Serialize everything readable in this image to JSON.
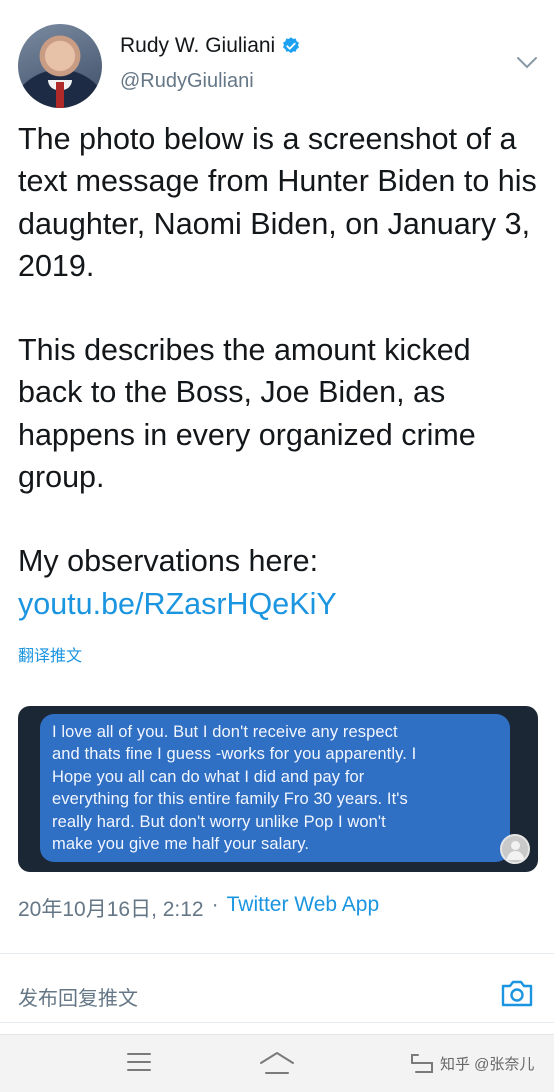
{
  "tweet": {
    "display_name": "Rudy W. Giuliani",
    "handle": "@RudyGiuliani",
    "paragraph_1": "The photo below is a screenshot of a text message from Hunter Biden to his daughter, Naomi Biden, on January 3, 2019.",
    "paragraph_2": "This describes the amount kicked back to the Boss, Joe Biden, as happens in every organized crime group.",
    "paragraph_3_text": "My observations here: ",
    "paragraph_3_link": "youtu.be/RZasrHQeKiY",
    "translate_label": "翻译推文",
    "timestamp": "20年10月16日, 2:12",
    "separator": "·",
    "source": "Twitter Web App"
  },
  "message_image": {
    "lines": [
      "I love all of you. But I don't receive any respect",
      "and thats fine I guess -works for you apparently. I",
      "Hope you all can do what I did and pay for",
      "everything for this entire family Fro 30 years. It's",
      "really hard. But don't worry unlike Pop I won't",
      "make you give me half your salary."
    ]
  },
  "reply": {
    "placeholder": "发布回复推文"
  },
  "navbar": {
    "watermark": "知乎 @张奈儿"
  },
  "colors": {
    "link": "#1b95e0",
    "verified": "#1da1f2",
    "secondary_text": "#657786",
    "bubble": "#2f6fc4"
  },
  "icons": [
    "verified-badge-icon",
    "chevron-down-icon",
    "camera-icon",
    "menu-icon",
    "home-icon",
    "back-icon"
  ]
}
